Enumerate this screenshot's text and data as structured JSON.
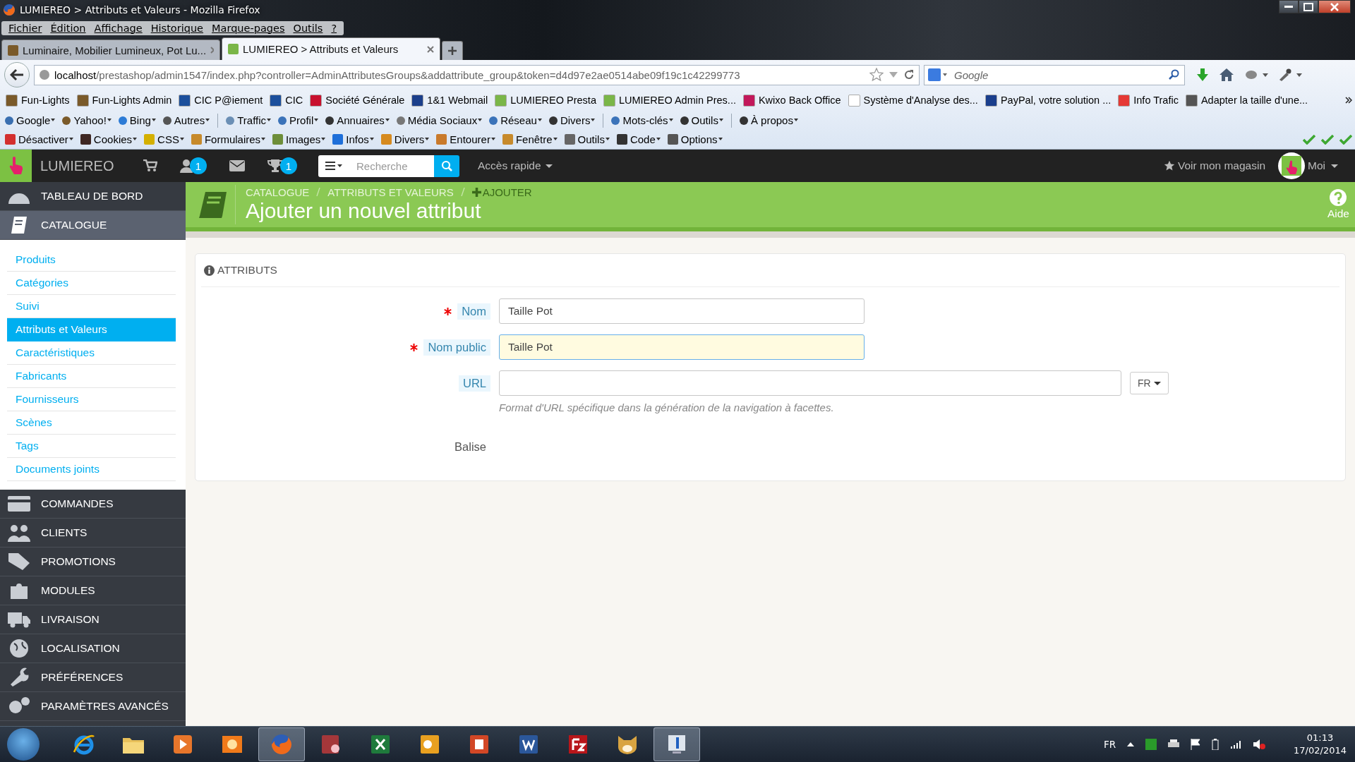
{
  "window": {
    "title": "LUMIEREO > Attributs et Valeurs - Mozilla Firefox"
  },
  "menu": [
    "Fichier",
    "Édition",
    "Affichage",
    "Historique",
    "Marque-pages",
    "Outils",
    "?"
  ],
  "tabs": [
    {
      "label": "Luminaire, Mobilier Lumineux, Pot Lu...",
      "selected": false
    },
    {
      "label": "LUMIEREO > Attributs et Valeurs",
      "selected": true
    }
  ],
  "address": {
    "host": "localhost",
    "path": "/prestashop/admin1547/index.php?controller=AdminAttributesGroups&addattribute_group&token=d4d97e2ae0514abe09f19c1c42299773"
  },
  "search": {
    "placeholder": "Google"
  },
  "bookmarks": [
    "Fun-Lights",
    "Fun-Lights Admin",
    "CIC P@iement",
    "CIC",
    "Société Générale",
    "1&1 Webmail",
    "LUMIEREO Presta",
    "LUMIEREO Admin Pres...",
    "Kwixo Back Office",
    "Système d'Analyse des...",
    "PayPal, votre solution ...",
    "Info Trafic",
    "Adapter la taille d'une..."
  ],
  "search_toolbar": [
    [
      "Google",
      "Yahoo!",
      "Bing",
      "Autres"
    ],
    [
      "Traffic",
      "Profil",
      "Annuaires",
      "Média Sociaux",
      "Réseau",
      "Divers"
    ],
    [
      "Mots-clés",
      "Outils"
    ],
    [
      "À propos"
    ]
  ],
  "dev_toolbar": [
    "Désactiver",
    "Cookies",
    "CSS",
    "Formulaires",
    "Images",
    "Infos",
    "Divers",
    "Entourer",
    "Fenêtre",
    "Outils",
    "Code",
    "Options"
  ],
  "admin_header": {
    "shop": "LUMIEREO",
    "customers_badge": "1",
    "trophy_badge": "1",
    "search_placeholder": "Recherche",
    "quick_access": "Accès rapide",
    "view_shop": "Voir mon magasin",
    "user": "Moi"
  },
  "page_header": {
    "breadcrumb": [
      "CATALOGUE",
      "ATTRIBUTS ET VALEURS",
      "AJOUTER"
    ],
    "title": "Ajouter un nouvel attribut",
    "help": "Aide"
  },
  "sidebar": {
    "items": [
      {
        "label": "TABLEAU DE BORD",
        "selected": false
      },
      {
        "label": "CATALOGUE",
        "selected": true,
        "children": [
          {
            "label": "Produits",
            "selected": false
          },
          {
            "label": "Catégories",
            "selected": false
          },
          {
            "label": "Suivi",
            "selected": false
          },
          {
            "label": "Attributs et Valeurs",
            "selected": true
          },
          {
            "label": "Caractéristiques",
            "selected": false
          },
          {
            "label": "Fabricants",
            "selected": false
          },
          {
            "label": "Fournisseurs",
            "selected": false
          },
          {
            "label": "Scènes",
            "selected": false
          },
          {
            "label": "Tags",
            "selected": false
          },
          {
            "label": "Documents joints",
            "selected": false
          }
        ]
      },
      {
        "label": "COMMANDES",
        "selected": false
      },
      {
        "label": "CLIENTS",
        "selected": false
      },
      {
        "label": "PROMOTIONS",
        "selected": false
      },
      {
        "label": "MODULES",
        "selected": false
      },
      {
        "label": "LIVRAISON",
        "selected": false
      },
      {
        "label": "LOCALISATION",
        "selected": false
      },
      {
        "label": "PRÉFÉRENCES",
        "selected": false
      },
      {
        "label": "PARAMÈTRES AVANCÉS",
        "selected": false
      }
    ]
  },
  "form": {
    "title": "ATTRIBUTS",
    "fields": [
      {
        "kind": "text",
        "label": "Nom",
        "required": true,
        "value": "Taille Pot",
        "focused": false
      },
      {
        "kind": "text",
        "label": "Nom public",
        "required": true,
        "value": "Taille Pot",
        "focused": true
      },
      {
        "kind": "url",
        "label": "URL",
        "required": false,
        "language": "FR",
        "help": "Format d'URL spécifique dans la génération de la navigation à facettes."
      },
      {
        "kind": "tags",
        "label": "Balise",
        "required": false
      }
    ]
  },
  "taskbar": {
    "apps": [
      {
        "kind": "ie",
        "selected": false
      },
      {
        "kind": "folder",
        "selected": false
      },
      {
        "kind": "media",
        "selected": false
      },
      {
        "kind": "paint",
        "selected": false
      },
      {
        "kind": "firefox",
        "selected": true
      },
      {
        "kind": "access",
        "selected": false
      },
      {
        "kind": "excel",
        "selected": false
      },
      {
        "kind": "outlook",
        "selected": false
      },
      {
        "kind": "powerpoint",
        "selected": false
      },
      {
        "kind": "word",
        "selected": false
      },
      {
        "kind": "filezilla",
        "selected": false
      },
      {
        "kind": "cat",
        "selected": false
      },
      {
        "kind": "monitor",
        "selected": true
      }
    ],
    "language": "FR",
    "time": "01:13",
    "date": "17/02/2014"
  }
}
